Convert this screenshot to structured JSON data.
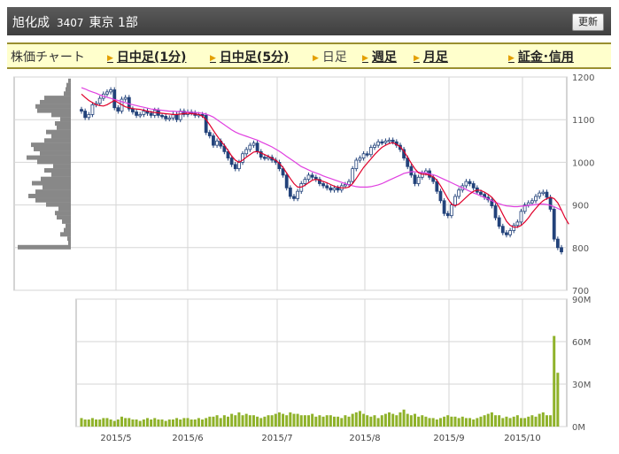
{
  "header": {
    "name": "旭化成",
    "code": "3407",
    "market": "東京 1部",
    "refresh_label": "更新"
  },
  "nav": {
    "label": "株価チャート",
    "intraday1": "日中足(1分)",
    "intraday5": "日中足(5分)",
    "daily": "日足",
    "weekly": "週足",
    "monthly": "月足",
    "margin": "証金･信用"
  },
  "colors": {
    "up": "#ffffff",
    "down": "#22427a",
    "ma_short": "#e0002a",
    "ma_long": "#e040e0",
    "volume": "#8fb22a",
    "profile": "#888888"
  },
  "chart_data": {
    "type": "candlestick",
    "price_axis": {
      "ticks": [
        700,
        800,
        900,
        1000,
        1100,
        1200
      ],
      "ylim": [
        700,
        1200
      ]
    },
    "volume_axis": {
      "ticks": [
        "0M",
        "30M",
        "60M",
        "90M"
      ],
      "ylim": [
        0,
        90
      ]
    },
    "x_tick_labels": [
      "2015/5",
      "2015/6",
      "2015/7",
      "2015/8",
      "2015/9",
      "2015/10"
    ],
    "close": [
      1120,
      1105,
      1112,
      1135,
      1138,
      1150,
      1160,
      1165,
      1170,
      1128,
      1120,
      1148,
      1152,
      1125,
      1118,
      1110,
      1112,
      1120,
      1115,
      1110,
      1122,
      1110,
      1108,
      1102,
      1104,
      1112,
      1100,
      1120,
      1112,
      1118,
      1116,
      1110,
      1112,
      1110,
      1070,
      1062,
      1040,
      1050,
      1038,
      1025,
      1010,
      995,
      985,
      1000,
      1020,
      1030,
      1040,
      1045,
      1025,
      1012,
      1010,
      1012,
      1005,
      1000,
      985,
      970,
      940,
      920,
      915,
      932,
      950,
      960,
      970,
      965,
      960,
      950,
      945,
      940,
      935,
      940,
      935,
      945,
      948,
      955,
      985,
      1005,
      1010,
      1020,
      1018,
      1035,
      1040,
      1048,
      1046,
      1050,
      1052,
      1048,
      1040,
      1030,
      1010,
      990,
      970,
      950,
      965,
      975,
      980,
      965,
      955,
      932,
      910,
      880,
      875,
      900,
      920,
      935,
      945,
      955,
      950,
      940,
      930,
      925,
      918,
      912,
      898,
      870,
      850,
      835,
      830,
      840,
      852,
      860,
      885,
      900,
      905,
      910,
      920,
      928,
      930,
      918,
      890,
      820,
      800,
      790
    ],
    "ma_short": [
      1160,
      1152,
      1145,
      1140,
      1135,
      1133,
      1132,
      1135,
      1140,
      1145,
      1140,
      1135,
      1130,
      1128,
      1126,
      1125,
      1124,
      1122,
      1120,
      1118,
      1117,
      1116,
      1115,
      1114,
      1113,
      1112,
      1112,
      1113,
      1114,
      1115,
      1114,
      1113,
      1112,
      1108,
      1100,
      1088,
      1075,
      1062,
      1050,
      1040,
      1028,
      1015,
      1005,
      1000,
      1005,
      1012,
      1018,
      1024,
      1025,
      1022,
      1018,
      1014,
      1010,
      1005,
      998,
      988,
      975,
      962,
      950,
      942,
      942,
      946,
      952,
      958,
      960,
      958,
      955,
      952,
      948,
      944,
      942,
      940,
      940,
      942,
      950,
      962,
      975,
      988,
      998,
      1008,
      1018,
      1027,
      1035,
      1040,
      1044,
      1046,
      1042,
      1036,
      1026,
      1012,
      998,
      985,
      975,
      972,
      972,
      970,
      966,
      958,
      945,
      930,
      915,
      902,
      898,
      902,
      910,
      918,
      926,
      932,
      935,
      934,
      930,
      925,
      918,
      908,
      895,
      878,
      862,
      852,
      848,
      848,
      852,
      860,
      870,
      882,
      892,
      902,
      910,
      915,
      918,
      915,
      905,
      888,
      870,
      855
    ],
    "ma_long": [
      1175,
      1172,
      1168,
      1165,
      1162,
      1158,
      1155,
      1152,
      1150,
      1147,
      1145,
      1142,
      1140,
      1137,
      1135,
      1133,
      1131,
      1129,
      1127,
      1125,
      1124,
      1123,
      1122,
      1121,
      1120,
      1120,
      1119,
      1119,
      1118,
      1118,
      1117,
      1117,
      1116,
      1115,
      1113,
      1110,
      1106,
      1100,
      1094,
      1088,
      1082,
      1076,
      1071,
      1067,
      1064,
      1061,
      1058,
      1055,
      1052,
      1048,
      1044,
      1040,
      1036,
      1031,
      1026,
      1020,
      1014,
      1008,
      1002,
      996,
      990,
      986,
      982,
      978,
      975,
      972,
      968,
      965,
      962,
      959,
      956,
      953,
      950,
      947,
      945,
      943,
      942,
      942,
      942,
      943,
      945,
      947,
      950,
      954,
      958,
      962,
      966,
      970,
      974,
      976,
      978,
      978,
      977,
      976,
      975,
      973,
      971,
      968,
      964,
      960,
      956,
      952,
      948,
      944,
      940,
      936,
      932,
      928,
      925,
      921,
      918,
      914,
      910,
      906,
      903,
      900,
      898,
      897,
      896,
      896,
      897,
      898,
      899,
      900,
      901,
      902,
      902,
      901,
      899,
      896,
      892,
      888
    ],
    "volume": [
      6,
      5,
      5,
      6,
      5,
      5,
      6,
      6,
      5,
      4,
      5,
      7,
      6,
      6,
      5,
      5,
      4,
      5,
      6,
      5,
      6,
      5,
      5,
      4,
      5,
      5,
      6,
      5,
      6,
      6,
      5,
      5,
      6,
      5,
      6,
      7,
      7,
      8,
      6,
      8,
      7,
      9,
      8,
      10,
      8,
      9,
      8,
      8,
      7,
      6,
      7,
      8,
      8,
      9,
      10,
      9,
      8,
      10,
      9,
      9,
      8,
      8,
      8,
      9,
      7,
      8,
      7,
      8,
      8,
      7,
      7,
      6,
      8,
      7,
      9,
      10,
      11,
      9,
      8,
      7,
      8,
      6,
      8,
      9,
      10,
      9,
      8,
      10,
      12,
      9,
      8,
      9,
      7,
      8,
      7,
      6,
      6,
      5,
      6,
      7,
      8,
      7,
      7,
      6,
      7,
      6,
      6,
      5,
      6,
      7,
      8,
      9,
      10,
      8,
      8,
      6,
      7,
      6,
      7,
      8,
      6,
      6,
      7,
      8,
      7,
      9,
      10,
      8,
      8,
      64,
      38
    ]
  }
}
